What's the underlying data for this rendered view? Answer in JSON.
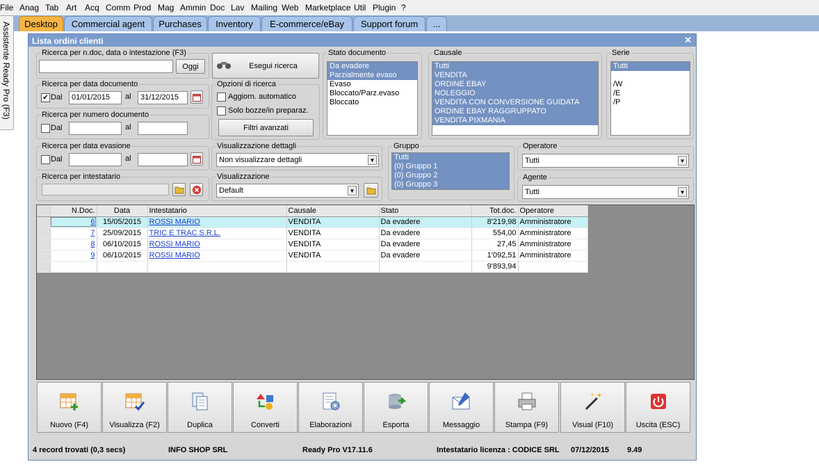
{
  "menu": [
    "File",
    "Anag",
    "Tab",
    "Art",
    "Acq",
    "Comm",
    "Prod",
    "Mag",
    "Ammin",
    "Doc",
    "Lav",
    "Mailing",
    "Web",
    "Marketplace",
    "Util",
    "Plugin",
    "?"
  ],
  "tabs": [
    "Desktop",
    "Commercial agent",
    "Purchases",
    "Inventory",
    "E-commerce/eBay",
    "Support forum",
    "..."
  ],
  "sidebar_label": "Assistente Ready Pro (F3)",
  "window_title": "Lista ordini clienti",
  "search": {
    "ndoc_label": "Ricerca per n.doc, data o intestazione (F3)",
    "oggi": "Oggi",
    "esegui": "Esegui ricerca",
    "data_doc_label": "Ricerca per data documento",
    "dal": "Dal",
    "al": "al",
    "date_from": "01/01/2015",
    "date_to": "31/12/2015",
    "num_doc_label": "Ricerca per numero documento",
    "data_evasione_label": "Ricerca per data evasione",
    "intestatario_label": "Ricerca per intestatario"
  },
  "options": {
    "label": "Opzioni di ricerca",
    "auto": "Aggiorn. automatico",
    "bozze": "Solo bozze/in preparaz.",
    "filtri": "Filtri avanzati"
  },
  "dettagli": {
    "label": "Visualizzazione dettagli",
    "value": "Non visualizzare dettagli"
  },
  "visualizzazione": {
    "label": "Visualizzazione",
    "value": "Default"
  },
  "stato": {
    "label": "Stato documento",
    "items": [
      "Da evadere",
      "Parzialmente evaso",
      "Evaso",
      "Bloccato/Parz.evaso",
      "Bloccato"
    ]
  },
  "causale": {
    "label": "Causale",
    "items": [
      "Tutti",
      "VENDITA",
      "ORDINE EBAY",
      "NOLEGGIO",
      "VENDITA CON CONVERSIONE GUIDATA",
      "ORDINE EBAY RAGGRUPPATO",
      "VENDITA PIXMANIA"
    ]
  },
  "serie": {
    "label": "Serie",
    "items": [
      "Tutti",
      "",
      "/W",
      "/E",
      "/P"
    ]
  },
  "gruppo": {
    "label": "Gruppo",
    "items": [
      "Tutti",
      "(0) Gruppo 1",
      "(0) Gruppo 2",
      "(0) Gruppo 3"
    ]
  },
  "operatore": {
    "label": "Operatore",
    "value": "Tutti"
  },
  "agente": {
    "label": "Agente",
    "value": "Tutti"
  },
  "grid": {
    "headers": [
      "N.Doc.",
      "Data",
      "Intestatario",
      "Causale",
      "Stato",
      "Tot.doc.",
      "Operatore"
    ],
    "rows": [
      [
        "6",
        "15/05/2015",
        "ROSSI MARIO",
        "VENDITA",
        "Da evadere",
        "8'219,98",
        "Amministratore"
      ],
      [
        "7",
        "25/09/2015",
        "TRIC E TRAC S.R.L.",
        "VENDITA",
        "Da evadere",
        "554,00",
        "Amministratore"
      ],
      [
        "8",
        "06/10/2015",
        "ROSSI MARIO",
        "VENDITA",
        "Da evadere",
        "27,45",
        "Amministratore"
      ],
      [
        "9",
        "06/10/2015",
        "ROSSI MARIO",
        "VENDITA",
        "Da evadere",
        "1'092,51",
        "Amministratore"
      ]
    ],
    "total": "9'893,94"
  },
  "toolbar": [
    "Nuovo (F4)",
    "Visualizza (F2)",
    "Duplica",
    "Converti",
    "Elaborazioni",
    "Esporta",
    "Messaggio",
    "Stampa (F9)",
    "Visual (F10)",
    "Uscita (ESC)"
  ],
  "status": {
    "records": "4 record trovati (0,3 secs)",
    "company": "INFO SHOP SRL",
    "version": "Ready Pro V17.11.6",
    "license": "Intestatario licenza : CODICE SRL",
    "date": "07/12/2015",
    "time": "9.49"
  }
}
